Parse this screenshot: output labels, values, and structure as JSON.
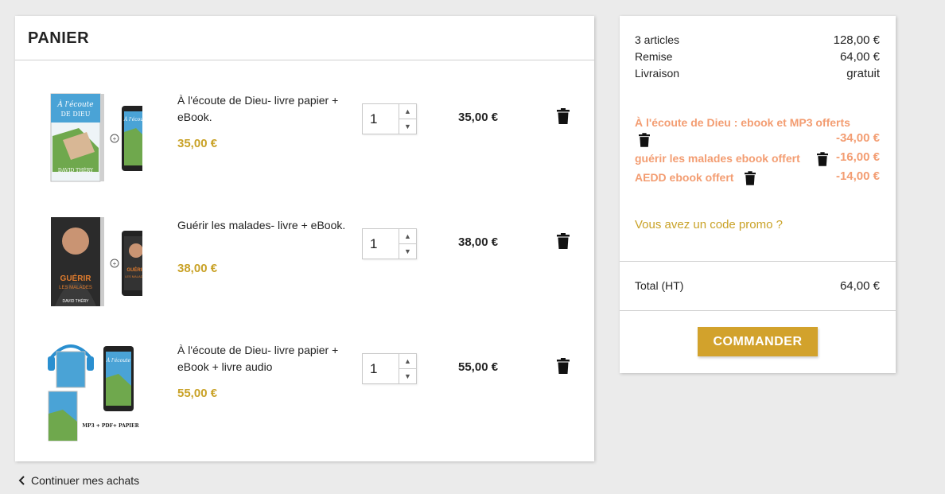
{
  "cart": {
    "title": "PANIER",
    "items": [
      {
        "name": "À l'écoute de Dieu- livre papier + eBook.",
        "unit_price": "35,00 €",
        "quantity": "1",
        "line_total": "35,00 €"
      },
      {
        "name": "Guérir les malades- livre + eBook.",
        "unit_price": "38,00 €",
        "quantity": "1",
        "line_total": "38,00 €"
      },
      {
        "name": "À l'écoute de Dieu- livre papier + eBook + livre audio",
        "unit_price": "55,00 €",
        "quantity": "1",
        "line_total": "55,00 €"
      }
    ],
    "thumb_text": {
      "cover1_title": "À l'écoute",
      "cover1_sub": "DE DIEU",
      "author": "DAVID THÉRY",
      "cover2_title": "GUÉRIR",
      "cover2_sub": "LES MALADES",
      "audio_caption": "MP3 + PDF+ PAPIER"
    }
  },
  "continue_label": "Continuer mes achats",
  "summary": {
    "articles_label": "3 articles",
    "articles_value": "128,00 €",
    "discount_label": "Remise",
    "discount_value": "64,00 €",
    "shipping_label": "Livraison",
    "shipping_value": "gratuit",
    "vouchers": [
      {
        "label": "À l'écoute de Dieu : ebook et MP3 offerts",
        "amount": "-34,00 €"
      },
      {
        "label": "guérir les malades ebook offert",
        "amount": "-16,00 €"
      },
      {
        "label": "AEDD ebook offert",
        "amount": "-14,00 €"
      }
    ],
    "promo_link": "Vous avez un code promo ?",
    "total_label": "Total (HT)",
    "total_value": "64,00 €",
    "order_button": "COMMANDER"
  },
  "colors": {
    "accent_gold": "#c9a227",
    "button_gold": "#d2a22c",
    "voucher_orange": "#f39d72",
    "background": "#ebebeb"
  }
}
